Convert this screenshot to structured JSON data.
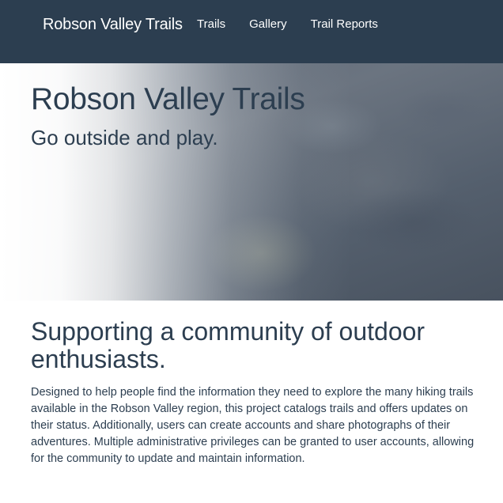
{
  "navbar": {
    "brand": "Robson Valley Trails",
    "links": [
      "Trails",
      "Gallery",
      "Trail Reports"
    ]
  },
  "hero": {
    "title": "Robson Valley Trails",
    "subtitle": "Go outside and play."
  },
  "main": {
    "heading": "Supporting a community of outdoor enthusiasts.",
    "description": "Designed to help people find the information they need to explore the many hiking trails available in the Robson Valley region, this project catalogs trails and offers updates on their status. Additionally, users can create accounts and share photographs of their adventures. Multiple administrative privileges can be granted to user accounts, allowing for the community to update and maintain information."
  },
  "colors": {
    "navbar_bg": "#2c3e50",
    "text": "#2c3e50",
    "nav_text": "#ffffff"
  }
}
